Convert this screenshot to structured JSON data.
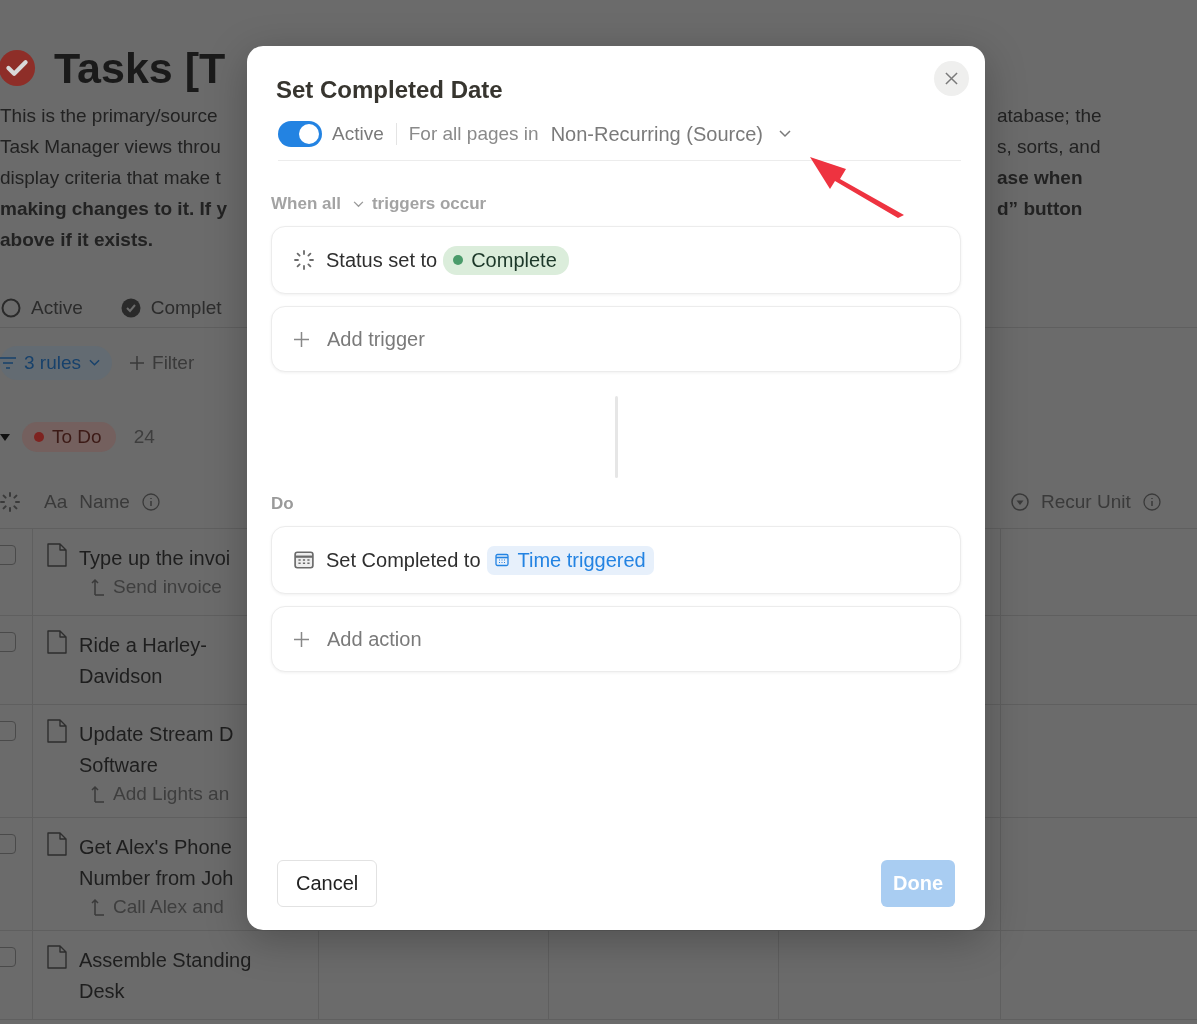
{
  "page": {
    "title": "Tasks [T",
    "description_left": [
      {
        "text": "This is the primary/source",
        "bold": false
      },
      {
        "text": "Task Manager views throu",
        "bold": false
      },
      {
        "text": "display criteria that make t",
        "bold": false
      },
      {
        "text": "making changes to it. If y",
        "bold": true
      },
      {
        "text": "above if it exists.",
        "bold": true
      }
    ],
    "description_right": [
      {
        "text": "atabase; the",
        "bold": false
      },
      {
        "text": "s, sorts, and",
        "bold": false
      },
      {
        "text": "ase when",
        "bold": true
      },
      {
        "text": "d” button",
        "bold": true
      }
    ],
    "views": [
      {
        "label": "Active",
        "kind": "circle"
      },
      {
        "label": "Complet",
        "kind": "check"
      }
    ],
    "filter": {
      "rules": "3 rules",
      "add": "Filter"
    },
    "group": {
      "label": "To Do",
      "count": "24",
      "expanded": true
    },
    "name_column": {
      "glyph": "Aa",
      "label": "Name"
    },
    "last_column": {
      "label": "Recur Unit"
    },
    "rows": [
      {
        "checked": false,
        "title_lines": [
          "Type up the invoi"
        ],
        "parent": "Send invoice"
      },
      {
        "checked": false,
        "title_lines": [
          "Ride a Harley-",
          "Davidson"
        ]
      },
      {
        "checked": false,
        "title_lines": [
          "Update Stream D",
          "Software"
        ],
        "parent": "Add Lights an"
      },
      {
        "checked": false,
        "title_lines": [
          "Get Alex's Phone",
          "Number from Joh"
        ],
        "parent": "Call Alex and"
      },
      {
        "checked": false,
        "title_lines": [
          "Assemble Standing",
          "Desk"
        ]
      }
    ]
  },
  "modal": {
    "title": "Set Completed Date",
    "active": {
      "on": true,
      "label": "Active"
    },
    "scope_prefix": "For all pages in",
    "scope": "Non-Recurring (Source)",
    "when_prefix": "When all",
    "when_suffix": "triggers occur",
    "triggers": [
      {
        "kind": "status",
        "text": "Status set to",
        "value": "Complete"
      }
    ],
    "add_trigger": "Add trigger",
    "do_label": "Do",
    "actions": [
      {
        "kind": "date",
        "text": "Set Completed to",
        "value": "Time triggered"
      }
    ],
    "add_action": "Add action",
    "cancel": "Cancel",
    "done": {
      "label": "Done",
      "disabled": true
    }
  }
}
